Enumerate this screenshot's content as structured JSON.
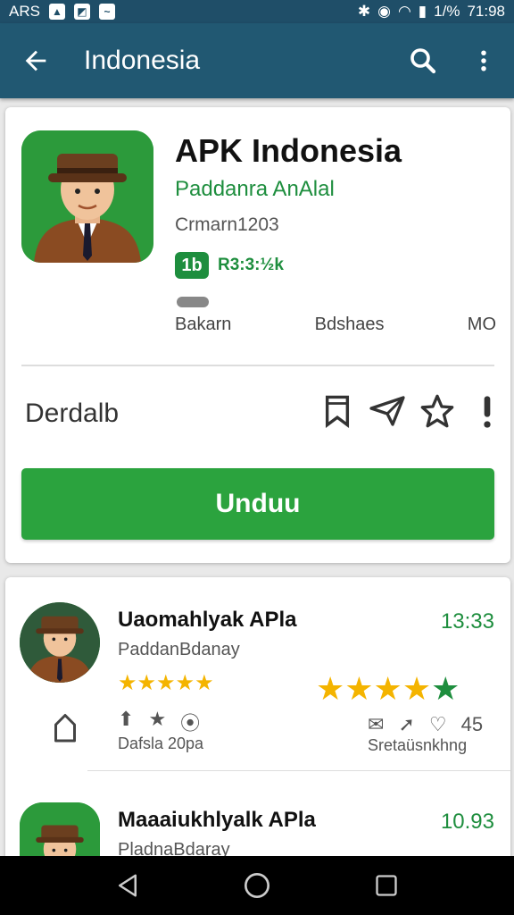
{
  "status_bar": {
    "left_text": "ARS",
    "time": "71:98",
    "battery": "1/%"
  },
  "app_bar": {
    "title": "Indonesia"
  },
  "app": {
    "title": "APK Indonesia",
    "developer": "Paddanra AnAlal",
    "meta": "Crmarn1203",
    "rating_badge": "1b",
    "rating_text": "R3:3:½k",
    "stats": [
      "Bakarn",
      "Bdshaes",
      "MO"
    ],
    "details_label": "Derdalb",
    "download_label": "Unduu"
  },
  "list": [
    {
      "title": "Uaomahlyak APla",
      "subtitle": "PaddanBdanay",
      "time": "13:33",
      "stars_small": "★★★★★",
      "stars_big": "★★★★★",
      "caption_left": "Dafsla  20pa",
      "caption_right": "Sretaüsnkhng",
      "count": "45"
    },
    {
      "title": "Maaaiukhlyalk APla",
      "subtitle": "PladnaBdaray",
      "time": "10.93"
    }
  ],
  "colors": {
    "app_bar": "#215872",
    "accent_green": "#2ba33e",
    "star": "#f4b400"
  }
}
